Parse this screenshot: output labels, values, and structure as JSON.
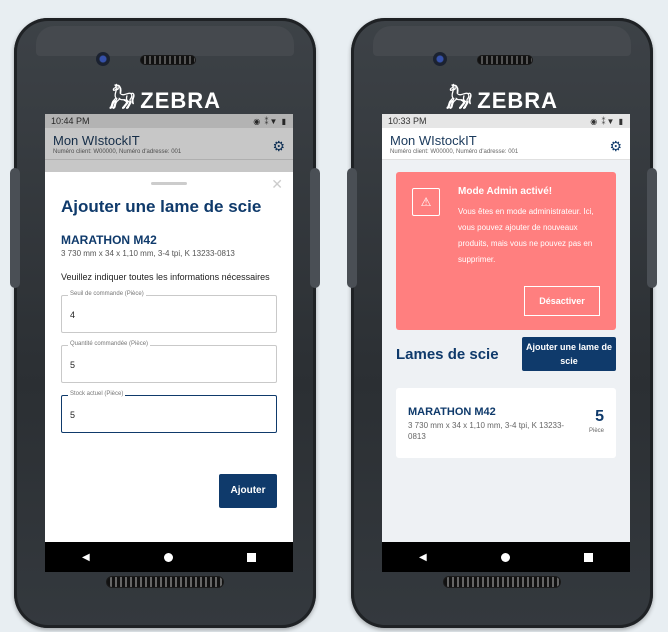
{
  "brand": "ZEBRA",
  "left": {
    "status": {
      "time": "10:44 PM",
      "icons": "◉ ⁑▼ ▮"
    },
    "app": {
      "title": "Mon WIstockIT",
      "subtitle": "Numéro client: W00000, Numéro d'adresse: 001"
    },
    "sheet": {
      "close": "✕",
      "heading": "Ajouter une lame de scie",
      "product_name": "MARATHON M42",
      "product_desc": "3 730 mm x 34 x 1,10 mm, 3-4 tpi, K   13233-0813",
      "instructions": "Veuillez indiquer toutes les informations nécessaires",
      "fields": [
        {
          "label": "Seuil de commande (Pièce)",
          "value": "4"
        },
        {
          "label": "Quantité commandée (Pièce)",
          "value": "5"
        },
        {
          "label": "Stock actuel (Pièce)",
          "value": "5"
        }
      ],
      "submit": "Ajouter"
    }
  },
  "right": {
    "status": {
      "time": "10:33 PM",
      "icons": "◉ ⁑▼ ▮"
    },
    "app": {
      "title": "Mon WIstockIT",
      "subtitle": "Numéro client: W00000, Numéro d'adresse: 001"
    },
    "alert": {
      "title": "Mode Admin activé!",
      "text": "Vous êtes en mode administrateur. Ici, vous pouvez ajouter de nouveaux produits, mais vous ne pouvez pas en supprimer.",
      "button": "Désactiver"
    },
    "section_title": "Lames de scie",
    "add_button": "Ajouter une lame de scie",
    "card": {
      "name": "MARATHON M42",
      "desc": "3 730 mm x 34 x 1,10 mm, 3-4 tpi, K 13233-0813",
      "quantity": "5",
      "unit": "Pièce"
    }
  },
  "colors": {
    "brand_blue": "#0f3a6b",
    "alert_red": "#ff7f7f"
  },
  "icons": [
    "gear-icon",
    "warning-icon",
    "close-icon",
    "back-icon",
    "home-icon",
    "recent-icon"
  ]
}
